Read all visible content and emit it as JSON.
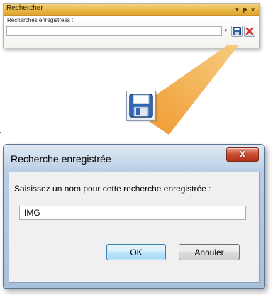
{
  "panel": {
    "title": "Rechercher",
    "controls": {
      "dropdown": "▾",
      "pin": "ᵽ",
      "close": "x"
    },
    "saved_searches_label": "Recherches enregistrées :",
    "saved_search_value": "",
    "combo_arrow": "▾",
    "buttons": [
      {
        "name": "save-search-button",
        "icon": "floppy-disk-icon"
      },
      {
        "name": "delete-search-button",
        "icon": "red-x-icon"
      }
    ]
  },
  "callout": {
    "icon": "floppy-disk-icon",
    "colors": {
      "beam": "#f2a33a",
      "floppy": "#2f66b3"
    }
  },
  "dialog": {
    "title": "Recherche enregistrée",
    "close_label": "X",
    "prompt": "Saisissez un nom pour cette recherche enregistrée :",
    "input_value": "IMG",
    "ok_label": "OK",
    "cancel_label": "Annuler"
  },
  "colors": {
    "panel_header": "#eab848",
    "dialog_frame": "#b4c9e1",
    "close_button": "#c94a2c",
    "delete_x": "#d22d2d"
  }
}
